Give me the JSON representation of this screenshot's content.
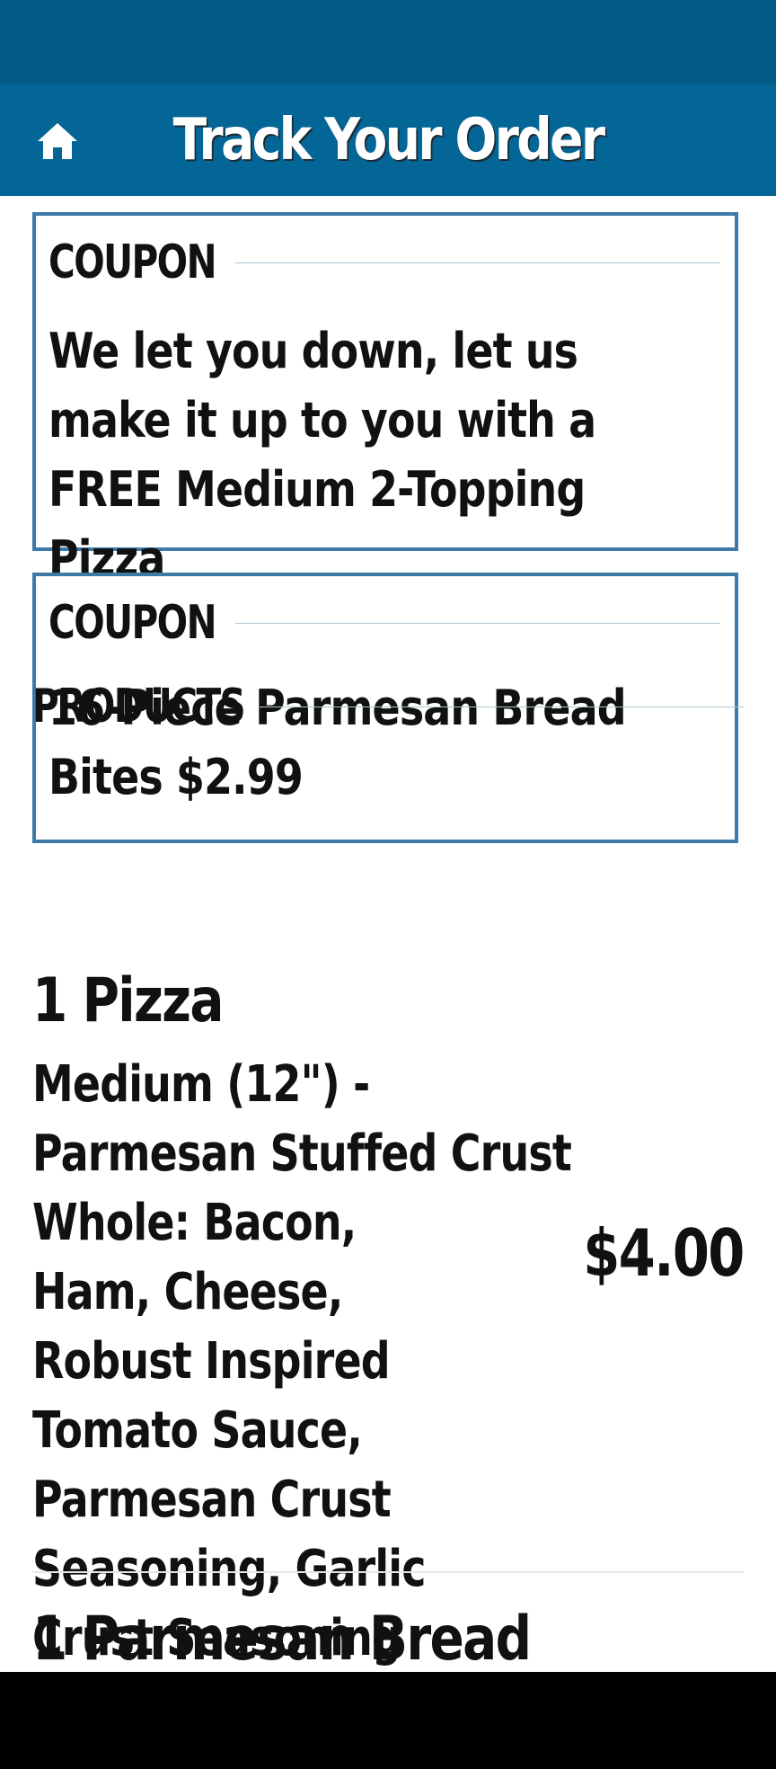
{
  "header": {
    "title": "Track Your Order",
    "home_icon": "home-icon",
    "colors": {
      "status_bar": "#035a85",
      "header_bg": "#036696"
    }
  },
  "coupons": [
    {
      "label": "COUPON",
      "text": "We let you down, let us make it up to you with a FREE Medium 2-Topping Pizza"
    },
    {
      "label": "COUPON",
      "text": "16-Piece Parmesan Bread Bites $2.99"
    }
  ],
  "products": {
    "heading": "PRODUCTS",
    "items": [
      {
        "title": "1 Pizza",
        "size_crust": "Medium (12\") - Parmesan Stuffed Crust",
        "toppings": "Whole: Bacon, Ham, Cheese, Robust Inspired Tomato Sauce, Parmesan Crust Seasoning, Garlic Crust Seasoning",
        "price": "$4.00"
      },
      {
        "title": "1 Parmesan Bread"
      }
    ]
  }
}
